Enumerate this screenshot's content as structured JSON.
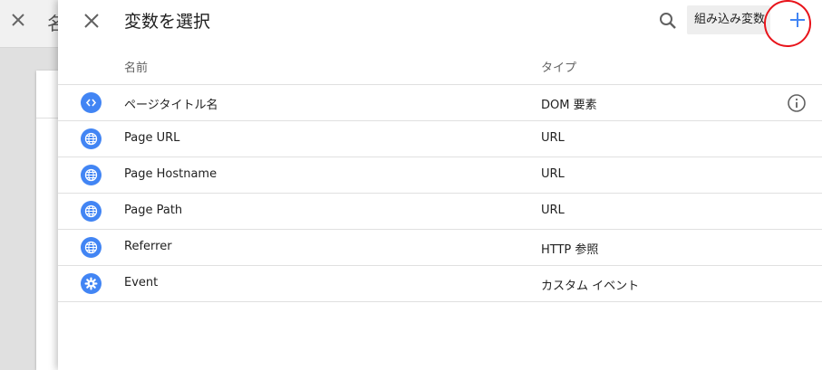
{
  "background": {
    "title_fragment": "名"
  },
  "drawer": {
    "title": "変数を選択",
    "builtin_button_label": "組み込み変数",
    "accent_color": "#4285f4",
    "highlight_color": "#e8141b"
  },
  "table": {
    "headers": {
      "name": "名前",
      "type": "タイプ"
    },
    "rows": [
      {
        "name": "ページタイトル名",
        "type": "DOM 要素",
        "icon": "code-icon",
        "has_info": true
      },
      {
        "name": "Page URL",
        "type": "URL",
        "icon": "globe-icon",
        "has_info": false
      },
      {
        "name": "Page Hostname",
        "type": "URL",
        "icon": "globe-icon",
        "has_info": false
      },
      {
        "name": "Page Path",
        "type": "URL",
        "icon": "globe-icon",
        "has_info": false
      },
      {
        "name": "Referrer",
        "type": "HTTP 参照",
        "icon": "globe-icon",
        "has_info": false
      },
      {
        "name": "Event",
        "type": "カスタム イベント",
        "icon": "gear-icon",
        "has_info": false
      }
    ]
  }
}
